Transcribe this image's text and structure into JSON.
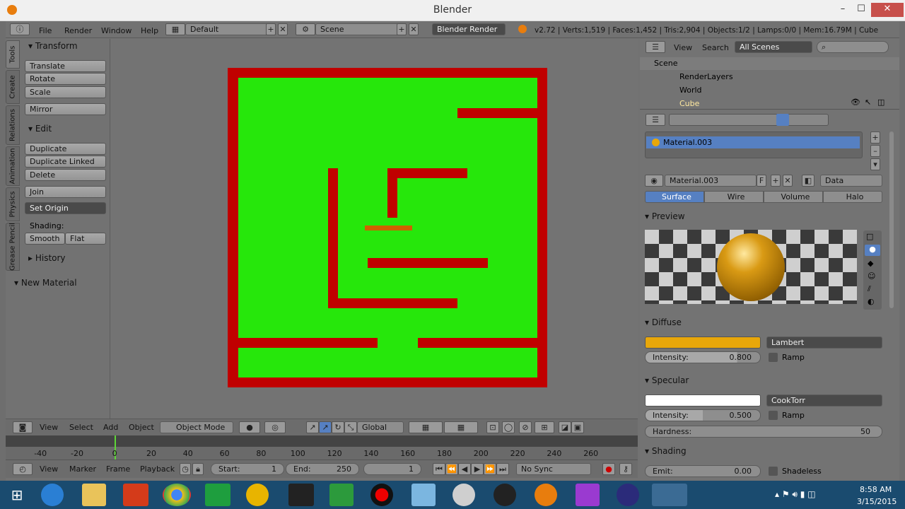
{
  "window": {
    "title": "Blender"
  },
  "menu": {
    "file": "File",
    "render": "Render",
    "window": "Window",
    "help": "Help"
  },
  "screen": "Default",
  "scene": "Scene",
  "engine": "Blender Render",
  "stats": "v2.72 | Verts:1,519 | Faces:1,452 | Tris:2,904 | Objects:1/2 | Lamps:0/0 | Mem:16.79M | Cube",
  "tabs": [
    "Tools",
    "Create",
    "Relations",
    "Animation",
    "Physics",
    "Grease Pencil"
  ],
  "tools": {
    "transform": "Transform",
    "translate": "Translate",
    "rotate": "Rotate",
    "scale": "Scale",
    "mirror": "Mirror",
    "edit": "Edit",
    "duplicate": "Duplicate",
    "duplicate_linked": "Duplicate Linked",
    "delete": "Delete",
    "join": "Join",
    "set_origin": "Set Origin",
    "shading": "Shading:",
    "smooth": "Smooth",
    "flat": "Flat",
    "history": "History",
    "new_material": "New Material"
  },
  "viewheader": {
    "view": "View",
    "select": "Select",
    "add": "Add",
    "object": "Object",
    "mode": "Object Mode",
    "orientation": "Global"
  },
  "timeline": {
    "ticks": [
      "-40",
      "-20",
      "0",
      "20",
      "40",
      "60",
      "80",
      "100",
      "120",
      "140",
      "160",
      "180",
      "200",
      "220",
      "240",
      "260"
    ],
    "view": "View",
    "marker": "Marker",
    "frame": "Frame",
    "playback": "Playback",
    "start_label": "Start:",
    "start": "1",
    "end_label": "End:",
    "end": "250",
    "current": "1",
    "sync": "No Sync"
  },
  "outliner": {
    "view": "View",
    "search": "Search",
    "filter": "All Scenes",
    "items": [
      "Scene",
      "RenderLayers",
      "World",
      "Cube"
    ]
  },
  "material": {
    "slot": "Material.003",
    "name": "Material.003",
    "f": "F",
    "data": "Data",
    "tabs": [
      "Surface",
      "Wire",
      "Volume",
      "Halo"
    ],
    "preview": "Preview",
    "diffuse": "Diffuse",
    "diffuse_color": "#e8a70a",
    "diffuse_shader": "Lambert",
    "diffuse_intensity_label": "Intensity:",
    "diffuse_intensity": "0.800",
    "ramp": "Ramp",
    "specular": "Specular",
    "spec_shader": "CookTorr",
    "spec_intensity_label": "Intensity:",
    "spec_intensity": "0.500",
    "hardness_label": "Hardness:",
    "hardness": "50",
    "shading": "Shading",
    "emit_label": "Emit:",
    "emit": "0.00",
    "shadeless": "Shadeless"
  },
  "clock": {
    "time": "8:58 AM",
    "date": "3/15/2015"
  },
  "colors": {
    "maze_wall": "#c00000",
    "maze_floor": "#26e70b",
    "player": "#d06000",
    "accent": "#5680c2"
  }
}
